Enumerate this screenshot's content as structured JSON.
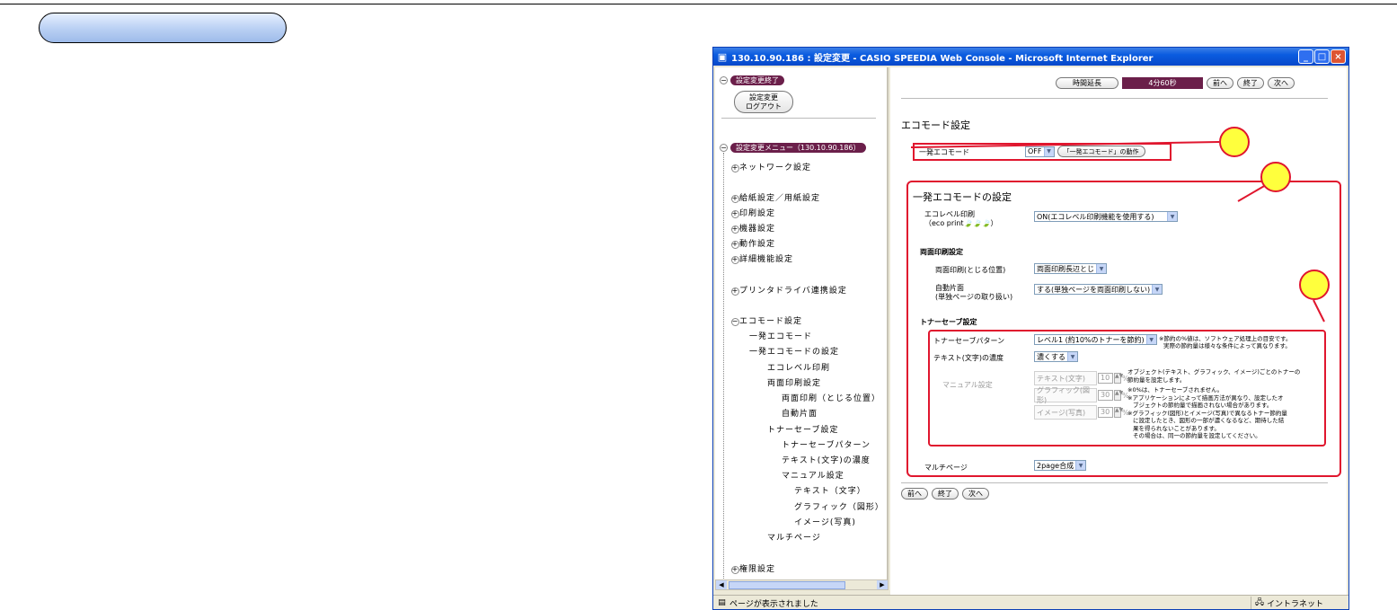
{
  "window": {
    "title": "130.10.90.186 : 設定変更 - CASIO SPEEDIA Web Console - Microsoft Internet Explorer"
  },
  "left": {
    "end_label": "設定変更終了",
    "logout_line1": "設定変更",
    "logout_line2": "ログアウト",
    "menu_label": "設定変更メニュー（130.10.90.186）",
    "tree": [
      "ネットワーク設定",
      "給紙設定／用紙設定",
      "印刷設定",
      "機器設定",
      "動作設定",
      "詳細機能設定",
      "プリンタドライバ連携設定",
      "エコモード設定",
      "一発エコモード",
      "一発エコモードの設定",
      "エコレベル印刷",
      "両面印刷設定",
      "両面印刷（とじる位置）",
      "自動片面",
      "トナーセーブ設定",
      "トナーセーブパターン",
      "テキスト(文字)の濃度",
      "マニュアル設定",
      "テキスト（文字）",
      "グラフィック（図形）",
      "イメージ(写真)",
      "マルチページ",
      "権限設定"
    ]
  },
  "toolbar": {
    "extend": "時間延長",
    "timer": "4分60秒",
    "prev": "前へ",
    "end": "終了",
    "next": "次へ"
  },
  "main": {
    "heading": "エコモード設定",
    "ippatsu_label": "一発エコモード",
    "ippatsu_value": "OFF",
    "ippatsu_button": "「一発エコモード」の動作",
    "section_title": "一発エコモードの設定",
    "eco_label1": "エコレベル印刷",
    "eco_label2": "（eco print",
    "eco_label3": "）",
    "eco_value": "ON(エコレベル印刷機能を使用する)",
    "duplex_title": "両面印刷設定",
    "duplex_pos_label": "両面印刷(とじる位置)",
    "duplex_pos_value": "両面印刷長辺とじ",
    "auto_label1": "自動片面",
    "auto_label2": "(単独ページの取り扱い)",
    "auto_value": "する(単独ページを両面印刷しない)",
    "toner_title": "トナーセーブ設定",
    "pattern_label": "トナーセーブパターン",
    "pattern_value": "レベル1 (約10%のトナーを節約)",
    "pattern_note1": "※節約の%値は、ソフトウェア処理上の目安です。",
    "pattern_note2": "実際の節約量は様々な条件によって異なります。",
    "density_label": "テキスト(文字)の濃度",
    "density_value": "濃くする",
    "manual_label": "マニュアル設定",
    "m_text": "テキスト(文字)",
    "m_graphic": "グラフィック(図形)",
    "m_image": "イメージ(写真)",
    "m_text_val": "10",
    "m_graphic_val": "30",
    "m_image_val": "30",
    "pct": "%",
    "manual_note1": "オブジェクト(テキスト、グラフィック、イメージ)ごとのトナーの",
    "manual_note2": "節約量を設定します。",
    "manual_note3": "※0%は、トナーセーブされません。",
    "manual_note4": "※アプリケーションによって描画方法が異なり、設定したオ",
    "manual_note5": "ブジェクトの節約量で描画されない場合があります。",
    "manual_note6": "※グラフィック(図形)とイメージ(写真)で異なるトナー節約量",
    "manual_note7": "に設定したとき、図形の一部が濃くなるなど、期待した結",
    "manual_note8": "果を得られないことがあります。",
    "manual_note9": "その場合は、同一の節約量を設定してください。",
    "multipage_label": "マルチページ",
    "multipage_value": "2page合成"
  },
  "status": {
    "text": "ページが表示されました",
    "zone": "イントラネット"
  },
  "colors": {
    "accent_red": "#e0162e",
    "callout_yellow": "#ffff3d",
    "menu_purple": "#6b1f4a",
    "titlebar_blue": "#0a5ce0"
  }
}
